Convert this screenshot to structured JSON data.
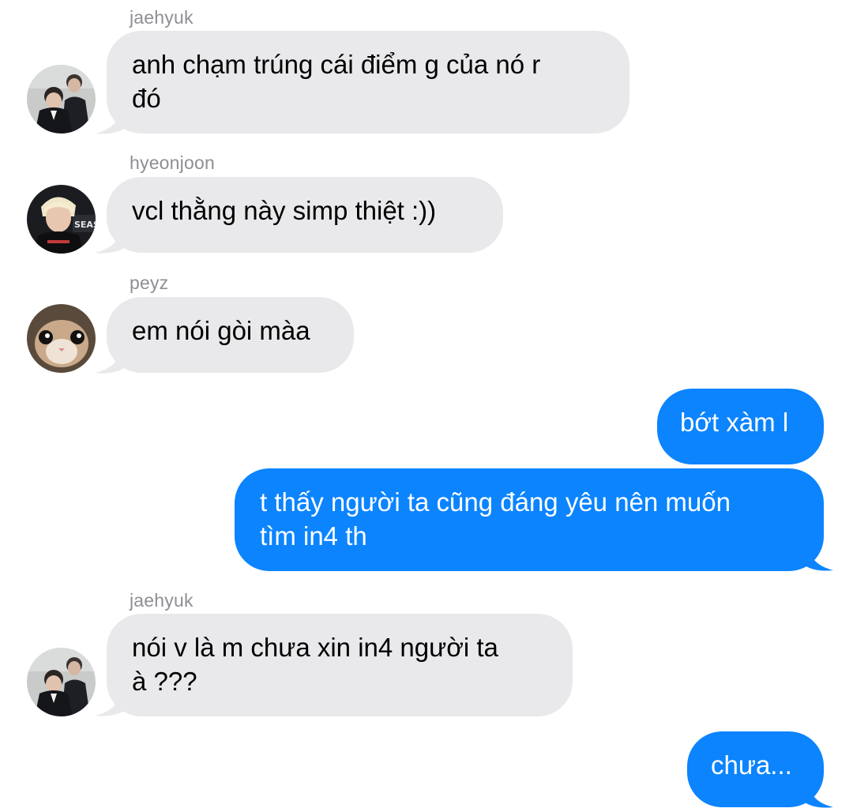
{
  "colors": {
    "incoming_bubble": "#e9e9eb",
    "outgoing_bubble": "#0b84fe",
    "sender_name": "#8e8e93"
  },
  "messages": [
    {
      "sender": "jaehyuk",
      "text": "anh chạm trúng cái điểm g của nó r\nđó",
      "direction": "incoming",
      "avatar": "jaehyuk-avatar"
    },
    {
      "sender": "hyeonjoon",
      "text": "vcl thằng này simp thiệt :))",
      "direction": "incoming",
      "avatar": "hyeonjoon-avatar"
    },
    {
      "sender": "peyz",
      "text": "em nói gòi màa",
      "direction": "incoming",
      "avatar": "peyz-cat-avatar"
    },
    {
      "text": "bớt xàm l",
      "direction": "outgoing"
    },
    {
      "text": "t thấy người ta cũng đáng yêu nên muốn\ntìm in4 th",
      "direction": "outgoing"
    },
    {
      "sender": "jaehyuk",
      "text": "nói v là m chưa xin in4 người ta\nà ???",
      "direction": "incoming",
      "avatar": "jaehyuk-avatar"
    },
    {
      "text": "chưa...",
      "direction": "outgoing"
    }
  ]
}
